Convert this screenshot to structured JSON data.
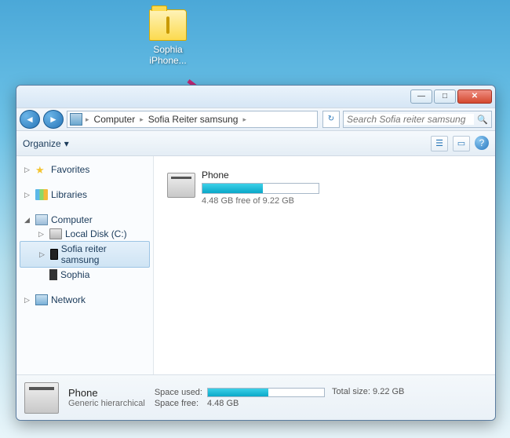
{
  "desktop": {
    "folder_label": "Sophia iPhone..."
  },
  "window": {
    "title_buttons": {
      "min": "—",
      "max": "□",
      "close": "✕"
    },
    "nav": {
      "back": "◄",
      "forward": "►"
    },
    "breadcrumb": {
      "root_icon": "computer-icon",
      "items": [
        "Computer",
        "Sofia Reiter samsung"
      ],
      "sep": "▸"
    },
    "refresh": "↻",
    "search": {
      "placeholder": "Search Sofia reiter samsung",
      "icon": "🔍"
    },
    "toolbar": {
      "organize": "Organize",
      "organize_arrow": "▾",
      "view_icon": "☰",
      "pane_icon": "▭",
      "help_icon": "?"
    }
  },
  "sidebar": {
    "favorites": "Favorites",
    "libraries": "Libraries",
    "computer": "Computer",
    "local_disk": "Local Disk (C:)",
    "sofia_device": "Sofia reiter samsung",
    "sophia": "Sophia",
    "network": "Network",
    "collapse": "▷",
    "expand": "◢"
  },
  "content": {
    "drive": {
      "name": "Phone",
      "free_text": "4.48 GB free of 9.22 GB",
      "used_percent": 52
    }
  },
  "details": {
    "title": "Phone",
    "subtitle": "Generic hierarchical",
    "space_used_label": "Space used:",
    "space_free_label": "Space free:",
    "space_free_value": "4.48 GB",
    "total_size_label": "Total size:",
    "total_size_value": "9.22 GB"
  }
}
